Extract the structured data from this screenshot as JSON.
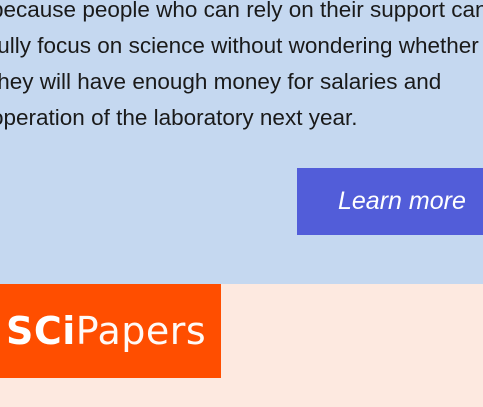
{
  "intro": {
    "lines": [
      "because people who can rely on their support can",
      "fully focus on science without wondering whether",
      "they will have enough money for salaries and",
      "operation of the laboratory next year."
    ]
  },
  "cta": {
    "label": "Learn more"
  },
  "logo": {
    "part1": "SCi",
    "part2": "Papers"
  },
  "colors": {
    "top_panel_bg": "#c5d8f0",
    "button_bg": "#525dd9",
    "logo_bg": "#ff4e00",
    "bottom_panel_bg": "#fde9e0"
  }
}
